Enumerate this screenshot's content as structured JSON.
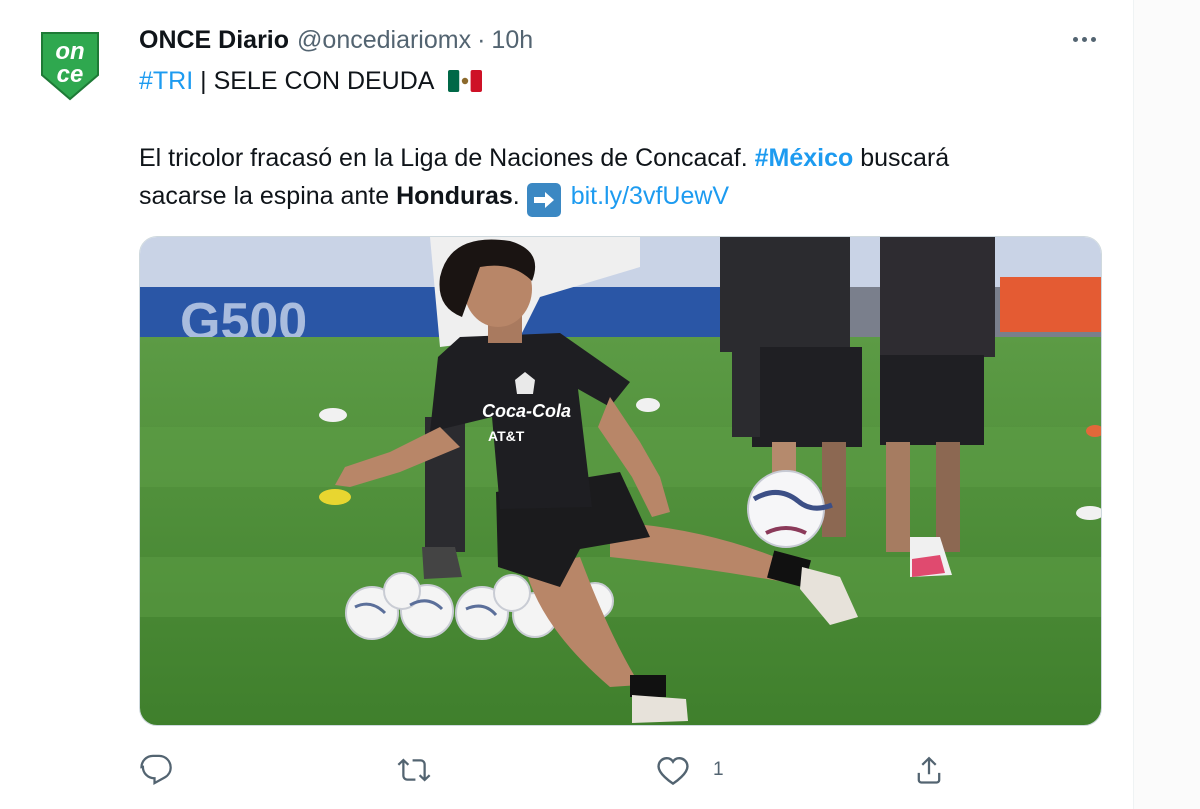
{
  "tweet": {
    "author": {
      "display_name": "ONCE Diario",
      "handle": "@oncediariomx",
      "separator": "·",
      "timestamp": "10h",
      "avatar_text_top": "on",
      "avatar_text_bottom": "ce",
      "avatar_color": "#2fa84f"
    },
    "line1": {
      "hashtag": "#TRI",
      "text": " | SELE CON DEUDA",
      "emoji": "mexico-flag"
    },
    "line2": {
      "text_a": "El tricolor fracasó en la Liga de Naciones de Concacaf. ",
      "hashtag": "#México",
      "text_b": " buscará"
    },
    "line3": {
      "text_a": "sacarse la espina ante ",
      "bold": "Honduras",
      "text_b": ". ",
      "emoji": "right-arrow-emoji",
      "link": "bit.ly/3vfUewV"
    },
    "media": {
      "subject": "soccer player kicking ball on training pitch",
      "shirt_sponsor_1": "Coca-Cola",
      "shirt_sponsor_2": "AT&T"
    },
    "actions": {
      "reply_icon": "reply-icon",
      "retweet_icon": "retweet-icon",
      "like_icon": "heart-icon",
      "like_count": "1",
      "share_icon": "share-icon"
    }
  },
  "colors": {
    "link": "#1d9bf0",
    "text": "#0f1419",
    "muted": "#536471",
    "pitch": "#4f8f3a"
  }
}
